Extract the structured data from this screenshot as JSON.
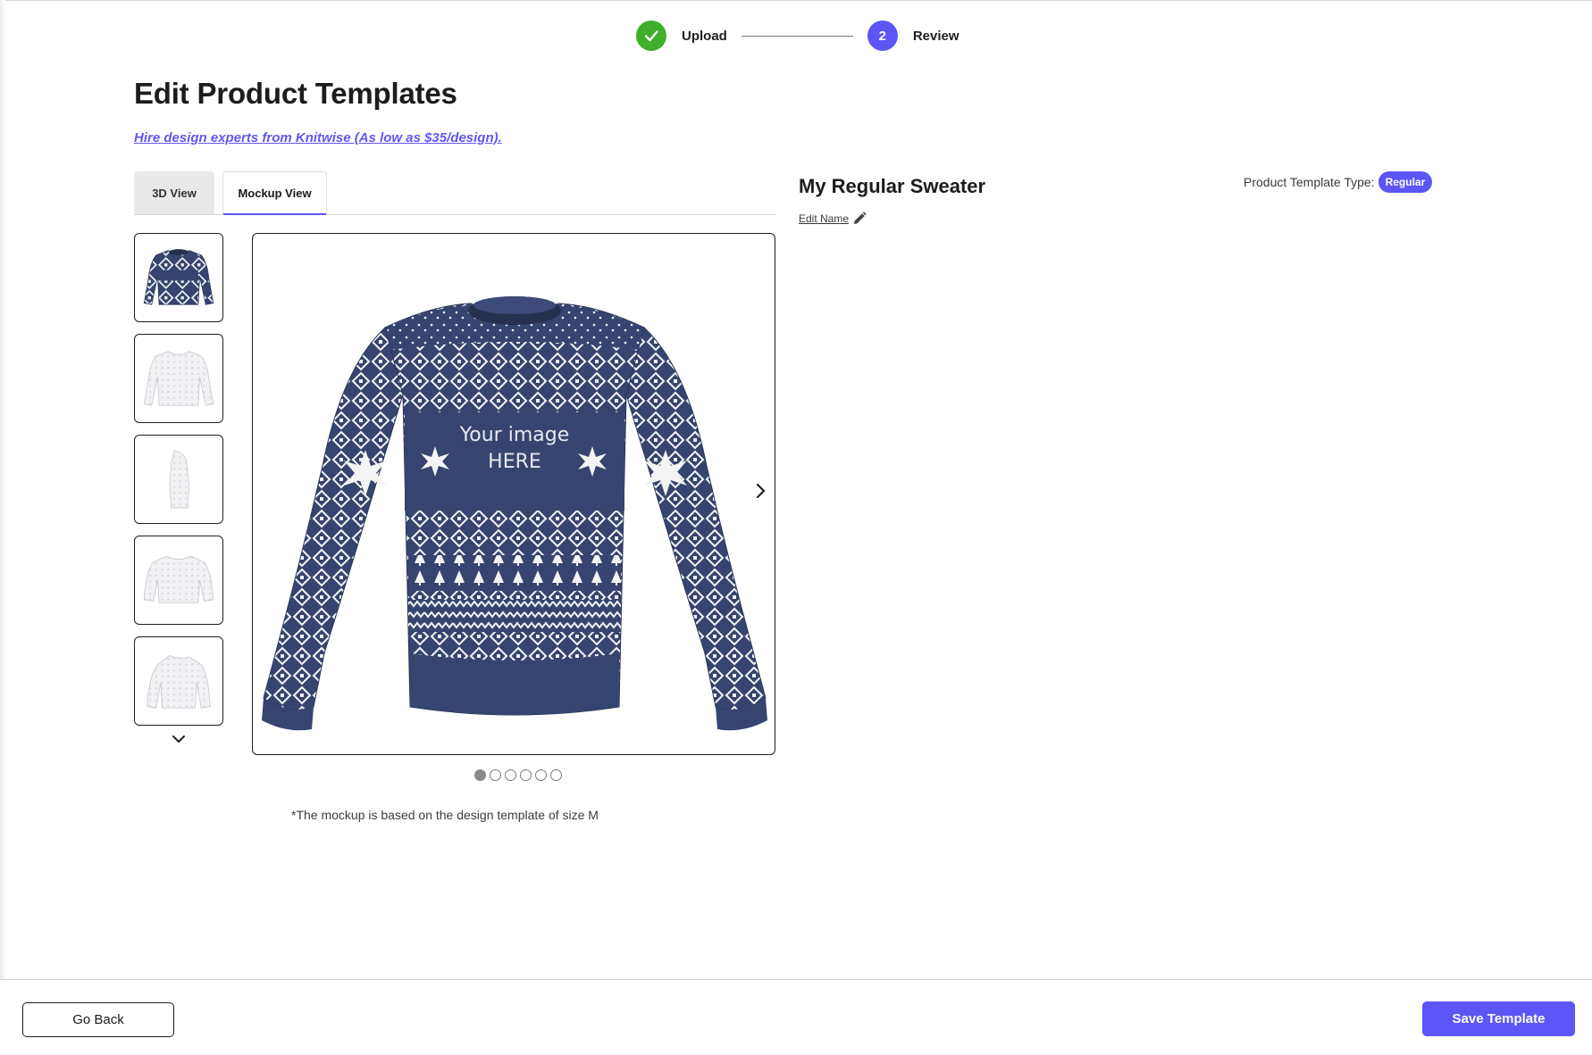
{
  "stepper": {
    "steps": [
      {
        "label": "Upload",
        "number": "1",
        "status": "done"
      },
      {
        "label": "Review",
        "number": "2",
        "status": "active"
      }
    ]
  },
  "page": {
    "title": "Edit Product Templates",
    "hire_link": "Hire design experts from Knitwise (As low as $35/design)."
  },
  "tabs": [
    {
      "label": "3D View",
      "selected": false
    },
    {
      "label": "Mockup View",
      "selected": true
    }
  ],
  "thumbnails": {
    "count_visible": 5,
    "selected_index": 0,
    "scroll_icon": "chevron-down-icon"
  },
  "viewer": {
    "image_text": "Your image HERE",
    "image_text_line1": "Your image",
    "image_text_line2": "HERE",
    "next_icon": "chevron-right-icon",
    "total_images": 6,
    "current_image": 1,
    "note": "*The mockup is based on the design template of size M"
  },
  "product": {
    "name": "My Regular Sweater",
    "edit_name_label": "Edit Name",
    "type_label": "Product Template Type:",
    "type_value": "Regular"
  },
  "footer": {
    "go_back_label": "Go Back",
    "save_label": "Save Template"
  },
  "colors": {
    "accent": "#5b56f5",
    "success": "#3fae2a",
    "sweater_navy": "#36456f"
  }
}
